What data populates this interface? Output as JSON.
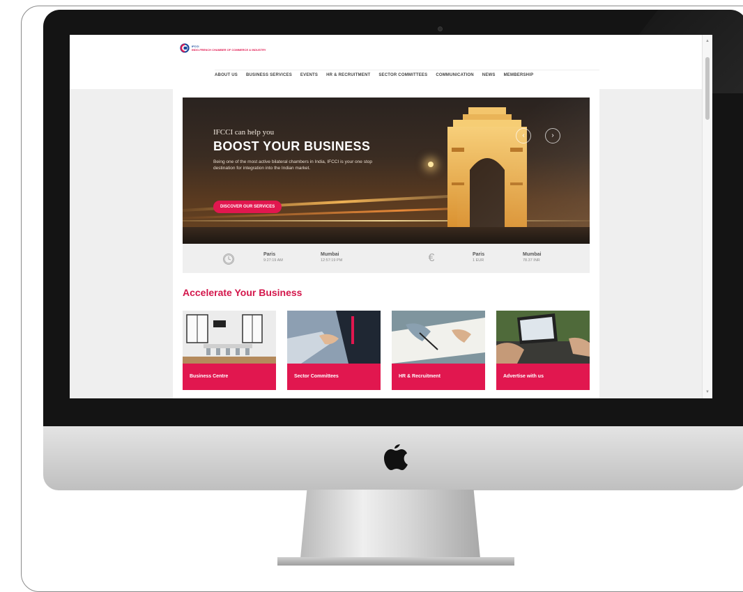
{
  "site": {
    "logo": {
      "line1": "IFCCI",
      "line2": "INDO-FRENCH CHAMBER OF COMMERCE & INDUSTRY",
      "line3": ""
    },
    "nav": [
      {
        "label": "ABOUT US"
      },
      {
        "label": "BUSINESS SERVICES"
      },
      {
        "label": "EVENTS"
      },
      {
        "label": "HR & RECRUITMENT"
      },
      {
        "label": "SECTOR COMMITTEES"
      },
      {
        "label": "COMMUNICATION"
      },
      {
        "label": "NEWS"
      },
      {
        "label": "MEMBERSHIP"
      }
    ]
  },
  "hero": {
    "kicker": "IFCCI can help you",
    "title": "BOOST YOUR BUSINESS",
    "description": "Being one of the most active bilateral chambers in India, IFCCI is your one stop destination for integration into the Indian market.",
    "button_label": "DISCOVER OUR SERVICES",
    "prev_arrow": "‹",
    "next_arrow": "›"
  },
  "info_bar": {
    "clock_icon": "clock-icon",
    "currency_icon": "euro-icon",
    "currency_symbol": "€",
    "times": [
      {
        "city": "Paris",
        "value": "9:27:19 AM"
      },
      {
        "city": "Mumbai",
        "value": "12:57:19 PM"
      }
    ],
    "rates": [
      {
        "city": "Paris",
        "value": "1 EUR"
      },
      {
        "city": "Mumbai",
        "value": "78.37 INR"
      }
    ]
  },
  "accelerate": {
    "title": "Accelerate Your Business",
    "cards": [
      {
        "label": "Business Centre"
      },
      {
        "label": "Sector Committees"
      },
      {
        "label": "HR & Recruitment"
      },
      {
        "label": "Advertise with us"
      }
    ]
  },
  "colors": {
    "brand_red": "#e1174f",
    "brand_blue": "#1d4b9b",
    "bezel": "#141414"
  }
}
